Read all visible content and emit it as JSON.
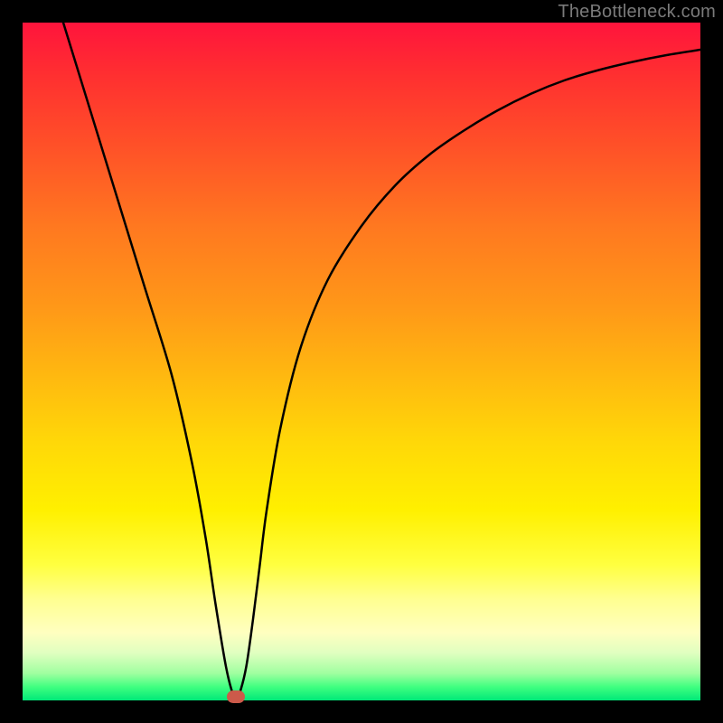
{
  "watermark": "TheBottleneck.com",
  "chart_data": {
    "type": "line",
    "title": "",
    "xlabel": "",
    "ylabel": "",
    "xlim": [
      0,
      100
    ],
    "ylim": [
      0,
      100
    ],
    "grid": false,
    "series": [
      {
        "name": "bottleneck-curve",
        "color": "#000000",
        "x": [
          6,
          10,
          14,
          18,
          22,
          25,
          27,
          28.5,
          30,
          31,
          31.5,
          32,
          33,
          34,
          35,
          36,
          38,
          41,
          45,
          50,
          55,
          60,
          65,
          70,
          75,
          80,
          85,
          90,
          95,
          100
        ],
        "y": [
          100,
          87,
          74,
          61,
          48,
          35,
          24,
          14,
          5,
          1,
          0.5,
          1,
          5,
          12,
          20,
          28,
          40,
          52,
          62,
          70,
          76,
          80.5,
          84,
          87,
          89.5,
          91.5,
          93,
          94.2,
          95.2,
          96
        ]
      }
    ],
    "marker": {
      "x": 31.5,
      "y": 0.5,
      "color": "#cc5a4a"
    },
    "gradient_stops": [
      {
        "pos": 0,
        "color": "#ff143c"
      },
      {
        "pos": 50,
        "color": "#ffd000"
      },
      {
        "pos": 85,
        "color": "#ffff80"
      },
      {
        "pos": 100,
        "color": "#00e878"
      }
    ]
  }
}
